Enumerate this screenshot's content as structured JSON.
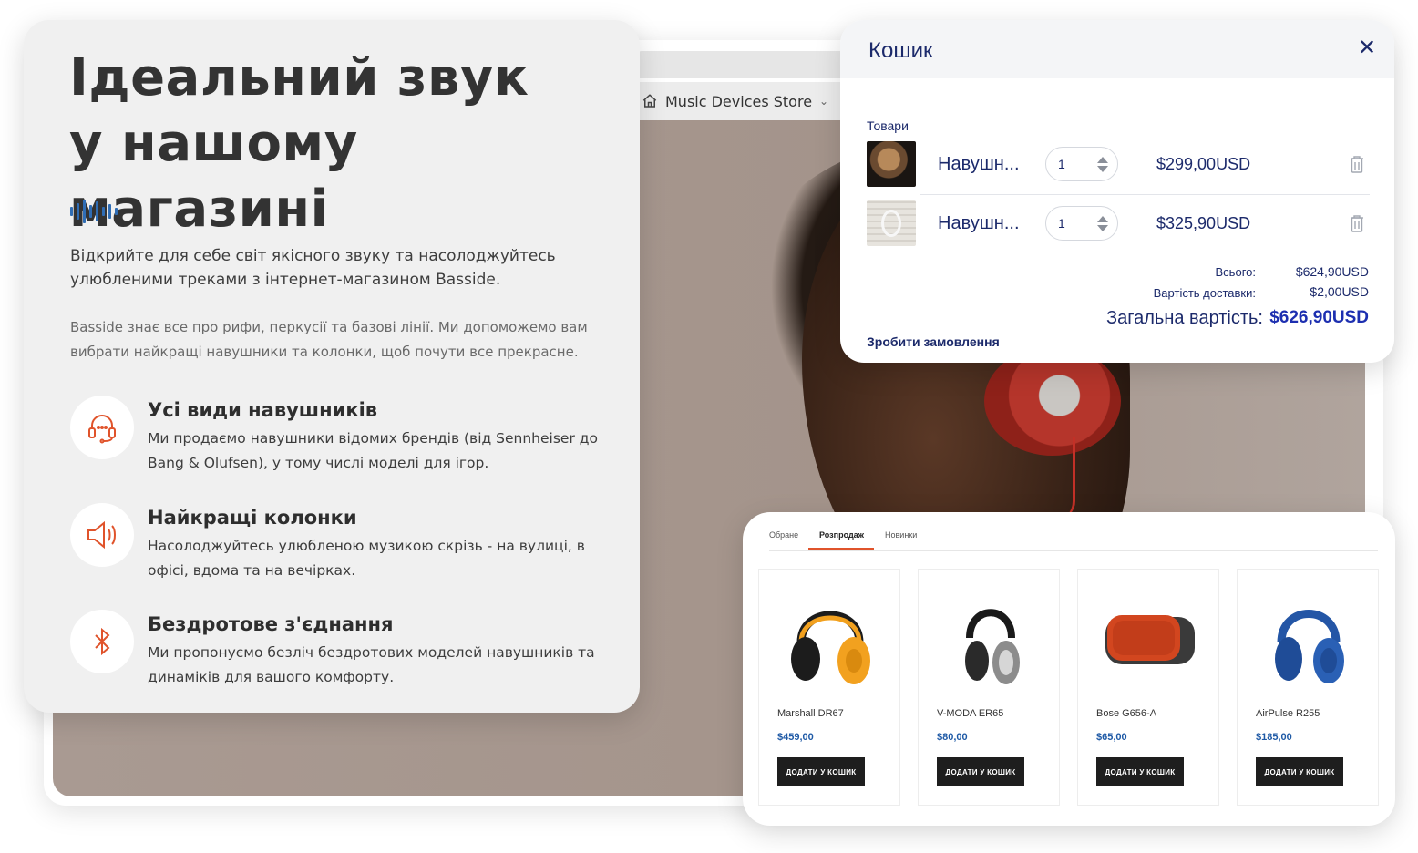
{
  "store_nav": {
    "label": "Music Devices Store"
  },
  "hero": {
    "title_line1": "Ідеальний звук",
    "title_line2": "у нашому магазині",
    "intro": "Відкрийте для себе світ якісного звуку та насолоджуйтесь улюбленими треками з інтернет-магазином Basside.",
    "sub": "Basside знає все про рифи, перкусії та базові лінії. Ми допоможемо вам вибрати найкращі навушники та колонки, щоб почути все прекрасне."
  },
  "features": [
    {
      "title": "Усі види навушників",
      "text": "Ми продаємо навушники відомих брендів (від Sennheiser до Bang & Olufsen), у тому числі моделі для ігор.",
      "icon": "headset-icon"
    },
    {
      "title": "Найкращі колонки",
      "text": "Насолоджуйтесь улюбленою музикою скрізь - на вулиці, в офісі, вдома та на вечірках.",
      "icon": "speaker-icon"
    },
    {
      "title": "Бездротове з'єднання",
      "text": "Ми пропонуємо безліч бездротових моделей навушників та динаміків для вашого комфорту.",
      "icon": "bluetooth-icon"
    }
  ],
  "cart": {
    "title": "Кошик",
    "section_label": "Товари",
    "items": [
      {
        "name": "Навушн...",
        "qty": "1",
        "price": "$299,00USD"
      },
      {
        "name": "Навушн...",
        "qty": "1",
        "price": "$325,90USD"
      }
    ],
    "subtotal_label": "Всього:",
    "subtotal_value": "$624,90USD",
    "shipping_label": "Вартість доставки:",
    "shipping_value": "$2,00USD",
    "total_label": "Загальна вартість:",
    "total_value": "$626,90USD",
    "checkout_label": "Зробити замовлення"
  },
  "products": {
    "tabs": [
      "Обране",
      "Розпродаж",
      "Новинки"
    ],
    "active_tab": "Розпродаж",
    "items": [
      {
        "name": "Marshall DR67",
        "price": "$459,00",
        "button": "ДОДАТИ У КОШИК"
      },
      {
        "name": "V-MODA ER65",
        "price": "$80,00",
        "button": "ДОДАТИ У КОШИК"
      },
      {
        "name": "Bose G656-A",
        "price": "$65,00",
        "button": "ДОДАТИ У КОШИК"
      },
      {
        "name": "AirPulse R255",
        "price": "$185,00",
        "button": "ДОДАТИ У КОШИК"
      }
    ]
  },
  "colors": {
    "accent_orange": "#e0532b",
    "cart_navy": "#1c2a6b",
    "total_blue": "#1d2fb0",
    "price_blue": "#1f5aa6",
    "wave_blue": "#2f6db5"
  }
}
